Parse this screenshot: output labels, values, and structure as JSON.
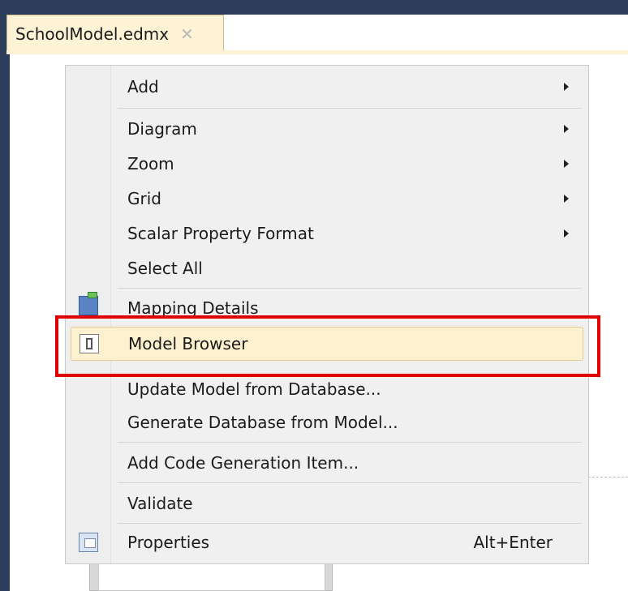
{
  "document_tab": {
    "title": "SchoolModel.edmx",
    "close_glyph": "✕"
  },
  "context_menu": {
    "items": [
      {
        "label": "Add",
        "submenu": true
      },
      {
        "label": "Diagram",
        "submenu": true
      },
      {
        "label": "Zoom",
        "submenu": true
      },
      {
        "label": "Grid",
        "submenu": true
      },
      {
        "label": "Scalar Property Format",
        "submenu": true
      },
      {
        "label": "Select All"
      },
      {
        "label": "Mapping Details",
        "icon": "mapping-details-icon"
      },
      {
        "label": "Model Browser",
        "icon": "model-browser-icon",
        "highlighted": true
      },
      {
        "label": "Update Model from Database..."
      },
      {
        "label": "Generate Database from Model..."
      },
      {
        "label": "Add Code Generation Item..."
      },
      {
        "label": "Validate"
      },
      {
        "label": "Properties",
        "icon": "properties-icon",
        "shortcut": "Alt+Enter"
      }
    ]
  },
  "colors": {
    "frame": "#2c3d5b",
    "tab_bg": "#fff3d6",
    "menu_bg": "#f0f0f0",
    "hover_bg": "#fdf1cf",
    "highlight_border": "#e00000"
  }
}
